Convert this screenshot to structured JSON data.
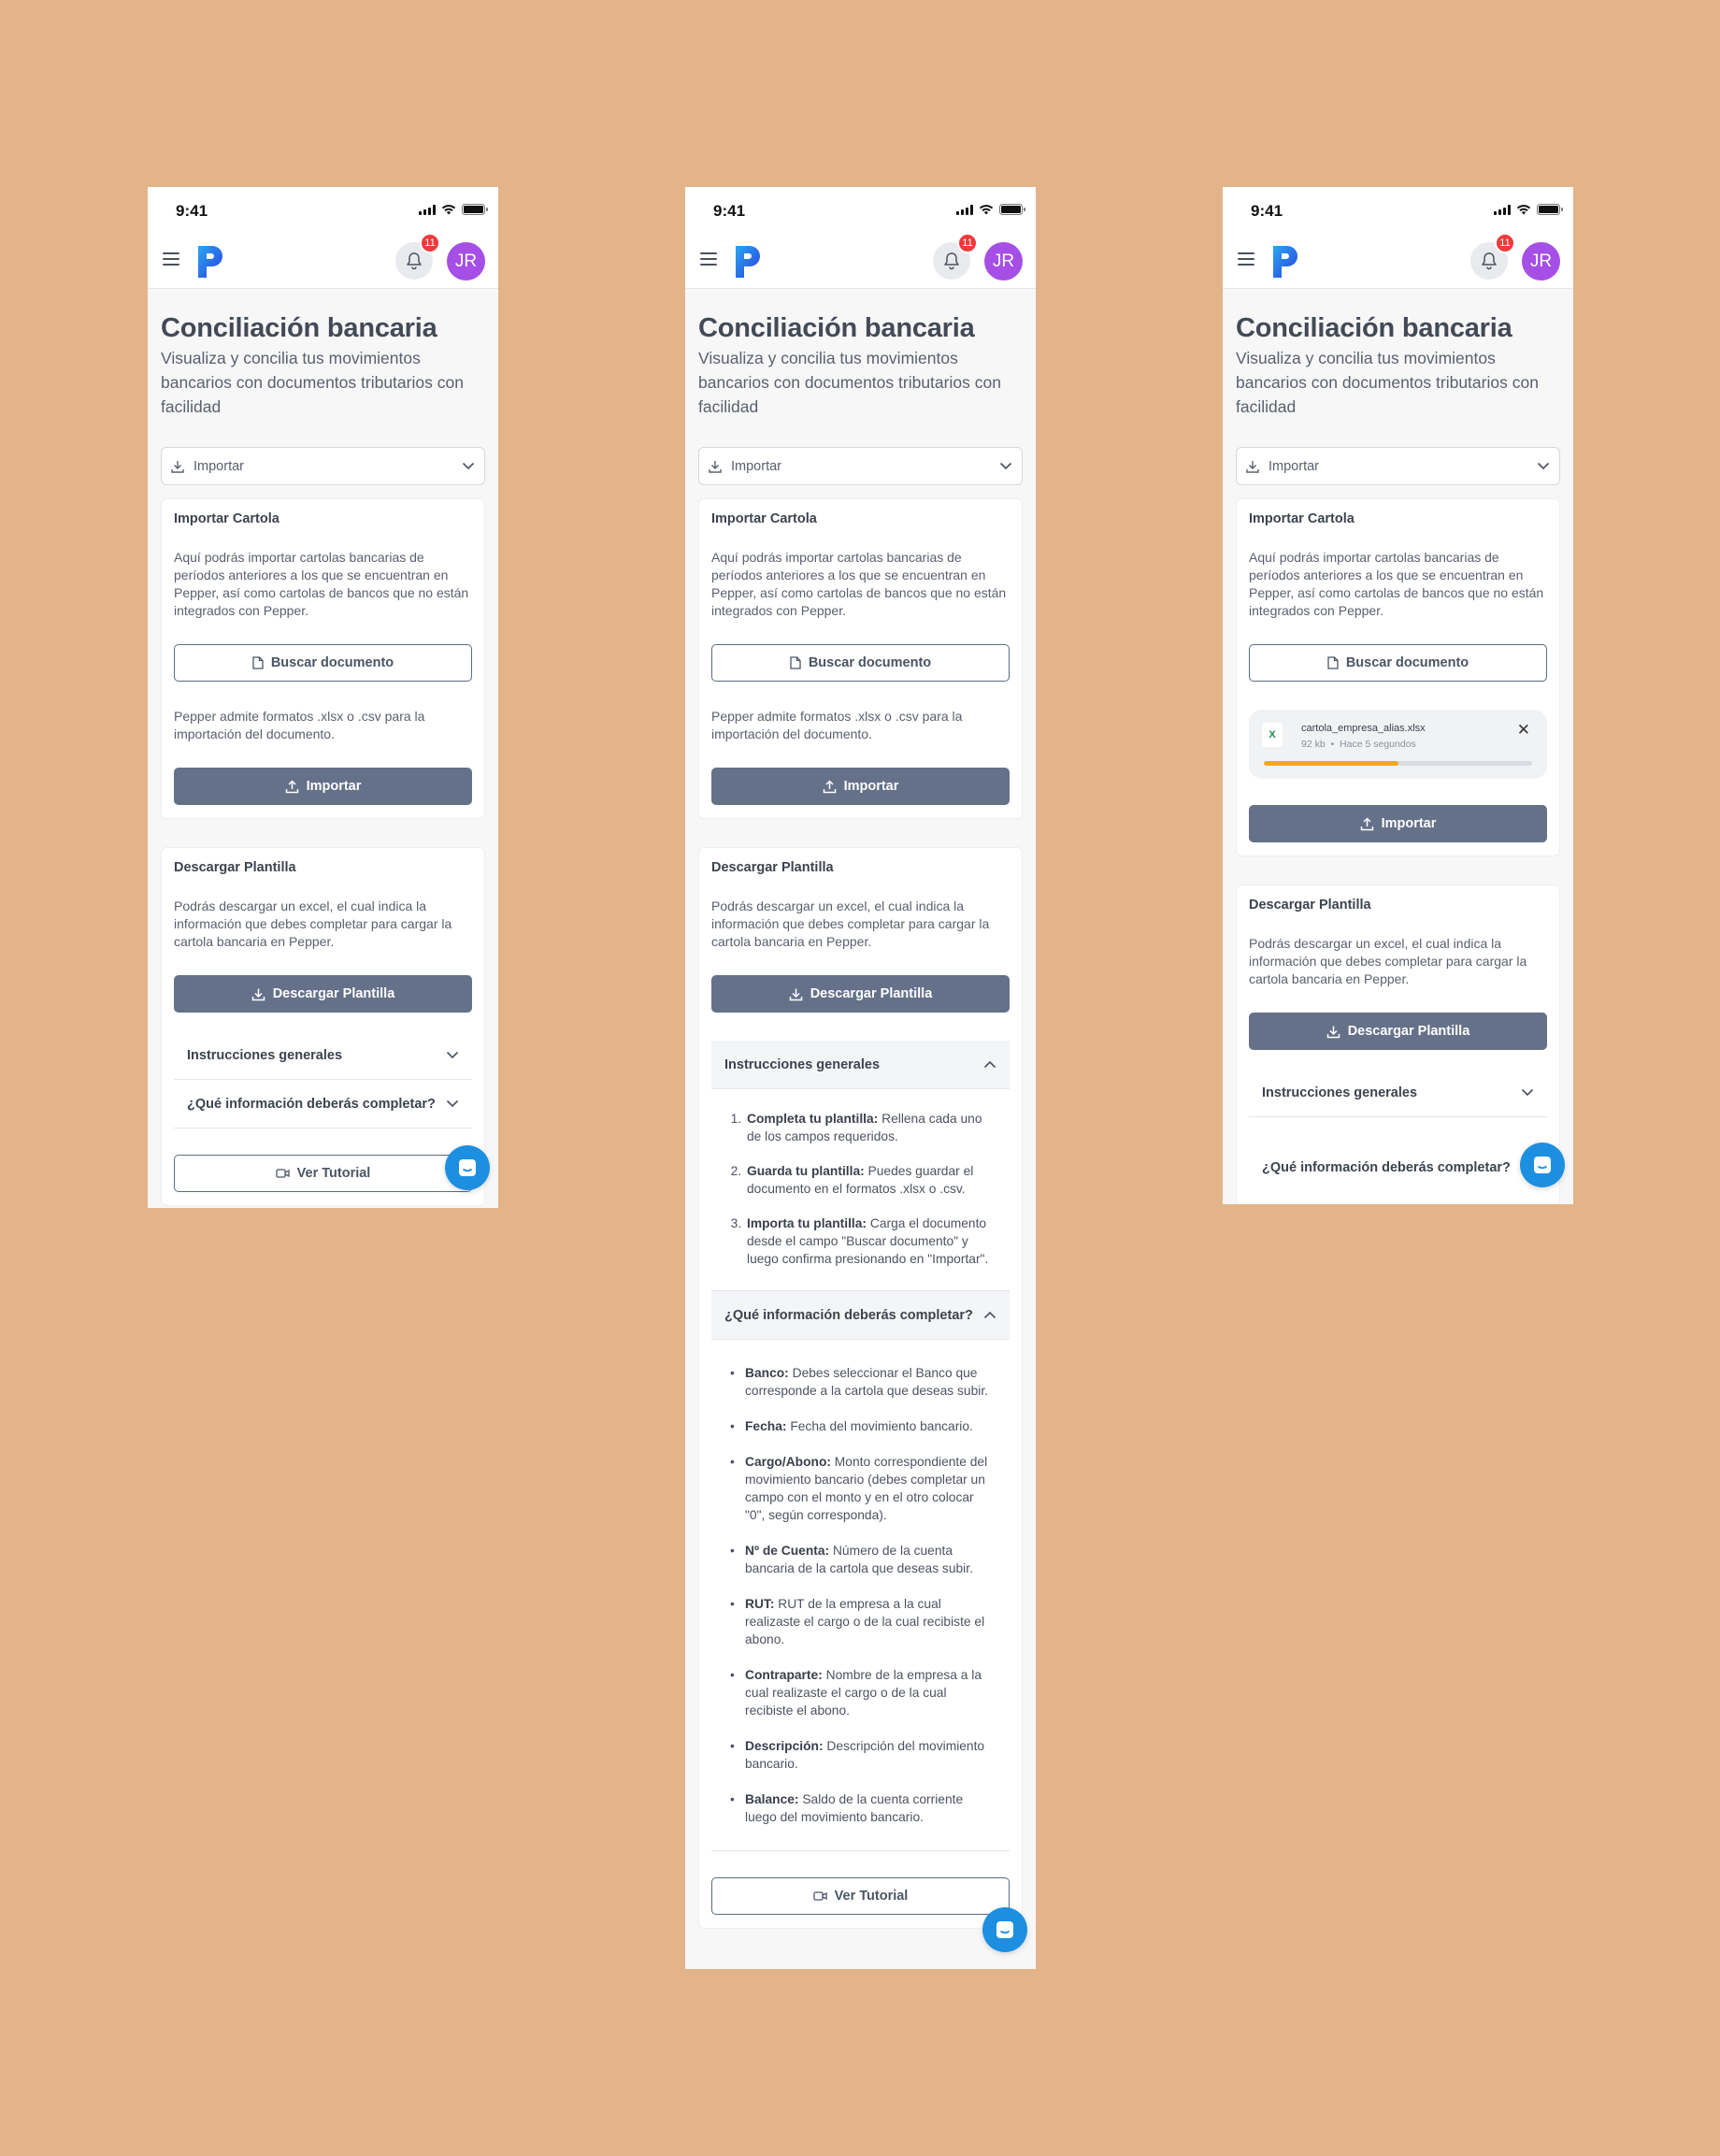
{
  "status": {
    "time": "9:41"
  },
  "header": {
    "notifications_count": "11",
    "avatar_initials": "JR"
  },
  "page": {
    "title": "Conciliación bancaria",
    "subtitle": "Visualiza y concilia tus movimientos bancarios con documentos tributarios con facilidad"
  },
  "import_select": {
    "label": "Importar"
  },
  "import_card": {
    "title": "Importar Cartola",
    "description": "Aquí podrás importar cartolas bancarias de períodos anteriores a los que se encuentran en Pepper, así como cartolas de bancos que no están integrados con Pepper.",
    "search_button": "Buscar documento",
    "formats_note": "Pepper admite formatos .xlsx o .csv para la importación del documento.",
    "import_button": "Importar"
  },
  "uploaded_file": {
    "name": "cartola_empresa_alias.xlsx",
    "size": "92 kb",
    "time": "Hace 5 segundos",
    "progress": 0.5
  },
  "template_card": {
    "title": "Descargar Plantilla",
    "description": "Podrás descargar un excel, el cual indica la información que debes completar para cargar la cartola bancaria en Pepper.",
    "download_button": "Descargar Plantilla"
  },
  "accordion": {
    "general": {
      "title": "Instrucciones generales",
      "items": [
        {
          "bold": "Completa tu plantilla:",
          "text": " Rellena cada uno de los campos requeridos."
        },
        {
          "bold": "Guarda tu plantilla:",
          "text": " Puedes guardar el documento en el formatos .xlsx o .csv."
        },
        {
          "bold": "Importa tu plantilla:",
          "text": " Carga el documento desde el campo \"Buscar documento\" y luego confirma presionando en \"Importar\"."
        }
      ]
    },
    "info": {
      "title": "¿Qué información deberás completar?",
      "items": [
        {
          "bold": "Banco:",
          "text": " Debes seleccionar el Banco que corresponde a la cartola que deseas subir."
        },
        {
          "bold": "Fecha:",
          "text": " Fecha del movimiento bancario."
        },
        {
          "bold": "Cargo/Abono:",
          "text": " Monto correspondiente del movimiento bancario (debes completar un campo con el monto y en el otro colocar \"0\", según corresponda)."
        },
        {
          "bold": "Nº de Cuenta:",
          "text": " Número de la cuenta bancaria de la cartola que deseas subir."
        },
        {
          "bold": "RUT:",
          "text": " RUT de la empresa a la cual realizaste el cargo o de la cual recibiste el abono."
        },
        {
          "bold": "Contraparte:",
          "text": " Nombre de la empresa a la cual realizaste el cargo o de la cual recibiste el abono."
        },
        {
          "bold": "Descripción:",
          "text": " Descripción del movimiento bancario."
        },
        {
          "bold": "Balance:",
          "text": " Saldo de la cuenta corriente luego del movimiento bancario."
        }
      ]
    }
  },
  "tutorial_button": "Ver Tutorial",
  "colors": {
    "primary_button": "#647189",
    "accent_blue": "#1d8fe1",
    "avatar": "#a54fe6",
    "badge": "#ee3b3b",
    "progress": "#f0a81c"
  }
}
